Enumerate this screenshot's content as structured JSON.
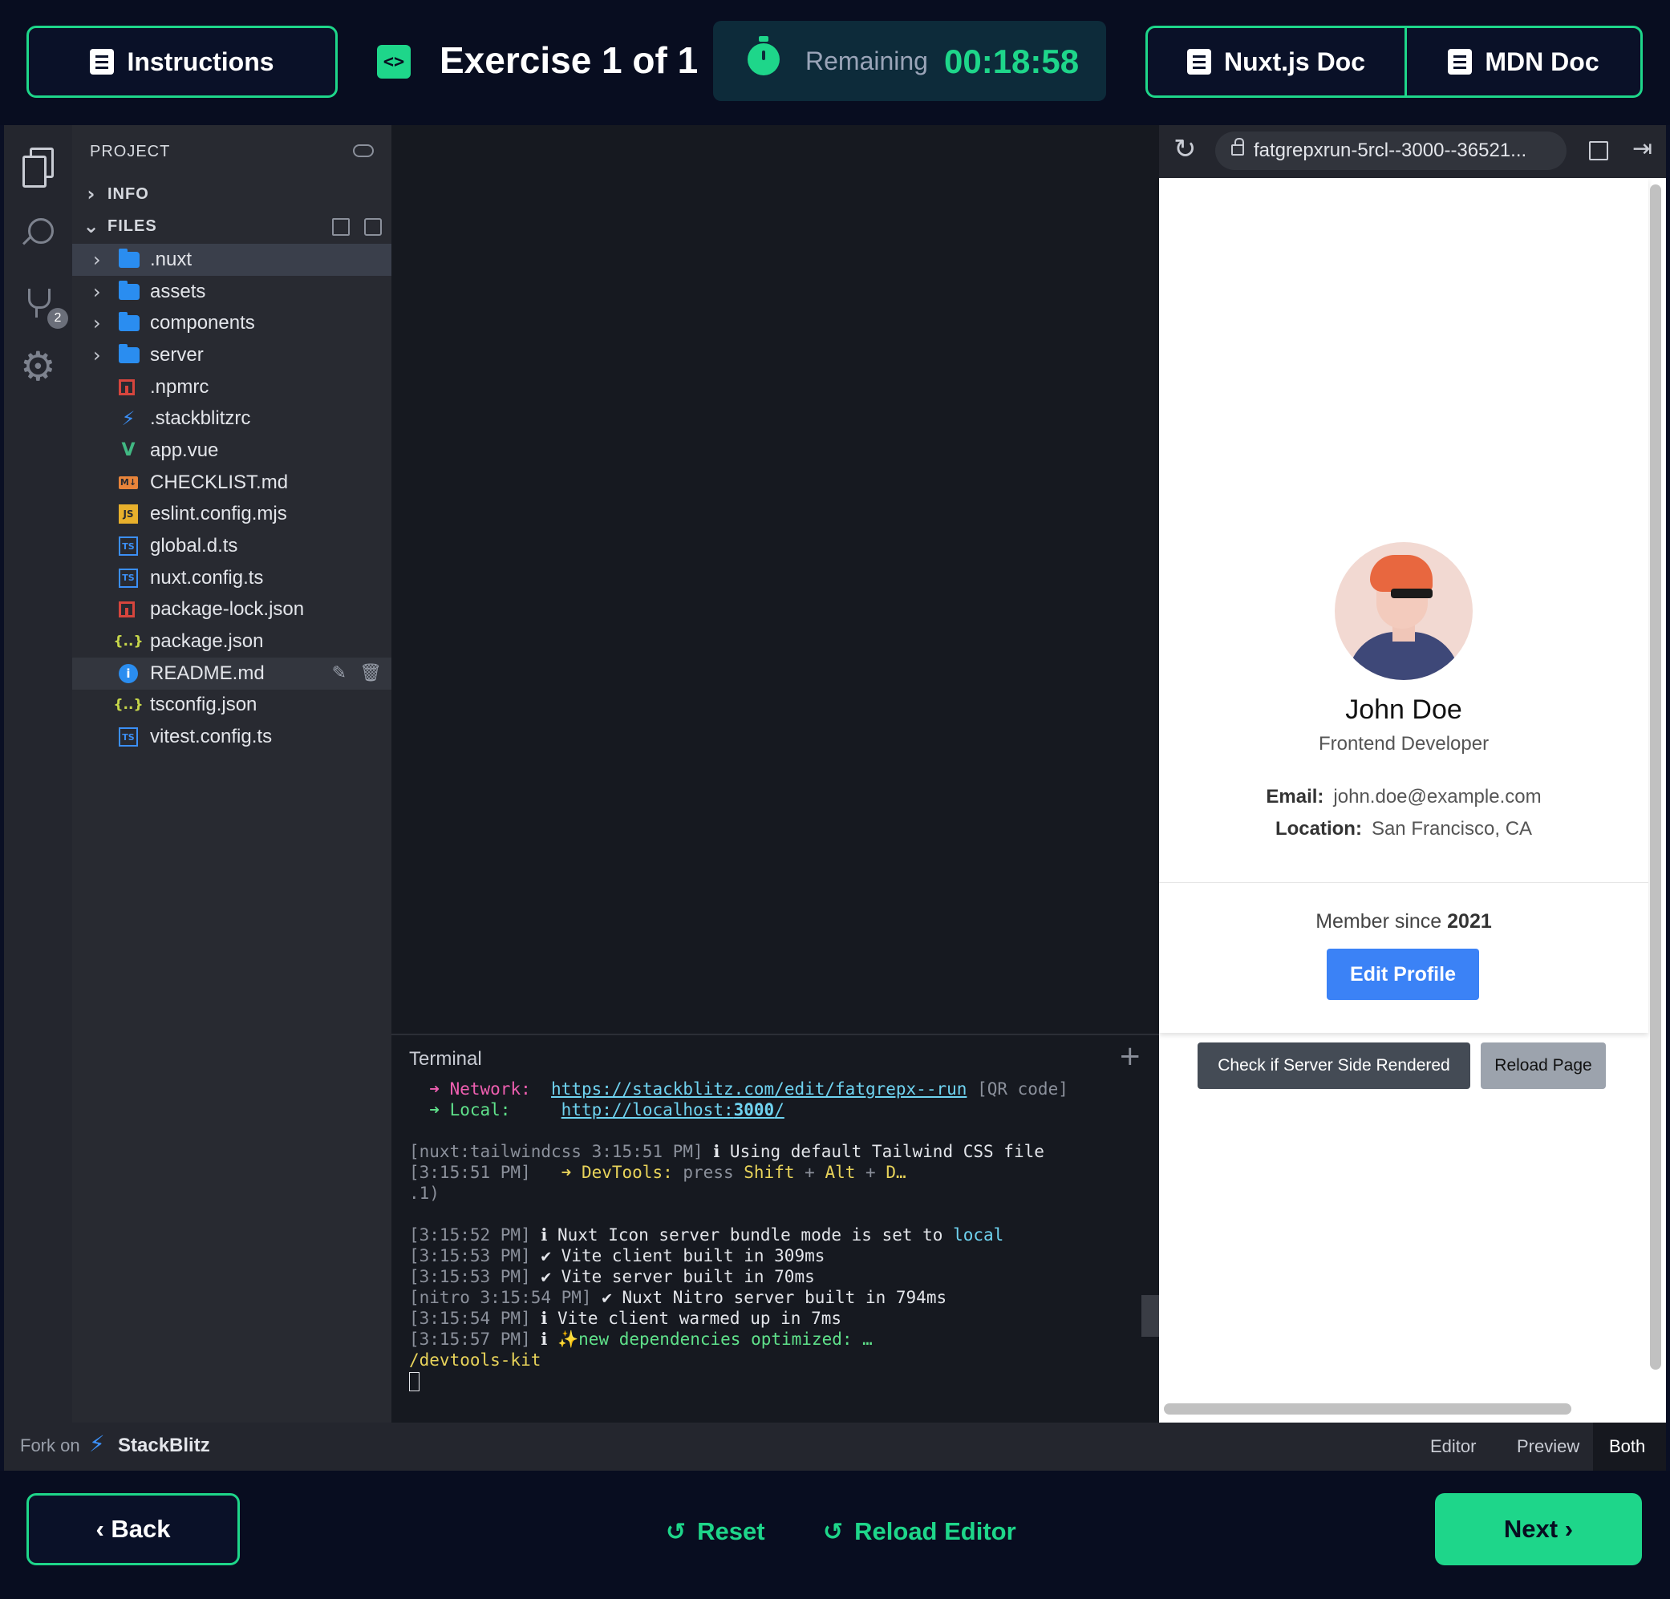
{
  "header": {
    "instructions_label": "Instructions",
    "code_icon_glyph": "<>",
    "exercise_title": "Exercise 1 of 1",
    "timer_label": "Remaining",
    "timer_value": "00:18:58",
    "nuxt_doc_label": "Nuxt.js Doc",
    "mdn_doc_label": "MDN Doc"
  },
  "activity_bar": {
    "icons": [
      "files-icon",
      "search-icon",
      "plug-icon",
      "gear-icon"
    ],
    "plug_badge": "2"
  },
  "sidebar": {
    "project_title": "PROJECT",
    "info_label": "INFO",
    "files_label": "FILES",
    "items": [
      {
        "label": ".nuxt",
        "type": "folder"
      },
      {
        "label": "assets",
        "type": "folder"
      },
      {
        "label": "components",
        "type": "folder"
      },
      {
        "label": "server",
        "type": "folder"
      },
      {
        "label": ".npmrc",
        "type": "npm"
      },
      {
        "label": ".stackblitzrc",
        "type": "bolt"
      },
      {
        "label": "app.vue",
        "type": "vue"
      },
      {
        "label": "CHECKLIST.md",
        "type": "md"
      },
      {
        "label": "eslint.config.mjs",
        "type": "js"
      },
      {
        "label": "global.d.ts",
        "type": "ts"
      },
      {
        "label": "nuxt.config.ts",
        "type": "ts"
      },
      {
        "label": "package-lock.json",
        "type": "npm"
      },
      {
        "label": "package.json",
        "type": "json"
      },
      {
        "label": "README.md",
        "type": "info"
      },
      {
        "label": "tsconfig.json",
        "type": "json"
      },
      {
        "label": "vitest.config.ts",
        "type": "ts"
      }
    ],
    "icon_glyphs": {
      "md": "M↓",
      "js": "JS",
      "ts": "TS",
      "json": "{..}",
      "info": "i",
      "bolt": "⚡",
      "vue": "V"
    }
  },
  "terminal": {
    "title": "Terminal",
    "network_arrow": "➜ Network:",
    "network_url": "https://stackblitz.com/edit/fatgrepx--run",
    "qr": "[QR code]",
    "local_arrow": "➜ Local:",
    "local_url_prefix": "http://localhost:",
    "local_url_port": "3000",
    "local_url_suffix": "/",
    "line_tw_prefix": "[nuxt:tailwindcss 3:15:51 PM]",
    "line_tw_text": "ℹ Using default Tailwind CSS file",
    "line_dev_prefix": "[3:15:51 PM]",
    "line_dev_arrow": "➜ DevTools:",
    "line_dev_press": "press",
    "line_dev_shift": "Shift",
    "line_dev_plus": "+",
    "line_dev_alt": "Alt",
    "line_dev_d": "D…",
    "line_dot1": ".1)",
    "line_icon_prefix": "[3:15:52 PM]",
    "line_icon_text": "ℹ Nuxt Icon server bundle mode is set to",
    "line_icon_local": "local",
    "line_vc_prefix": "[3:15:53 PM]",
    "line_vc_text": "✔ Vite client built in 309ms",
    "line_vs_prefix": "[3:15:53 PM]",
    "line_vs_text": "✔ Vite server built in 70ms",
    "line_nitro_prefix": "[nitro 3:15:54 PM]",
    "line_nitro_text": "✔ Nuxt Nitro server built in 794ms",
    "line_warm_prefix": "[3:15:54 PM]",
    "line_warm_text": "ℹ Vite client warmed up in 7ms",
    "line_deps_prefix": "[3:15:57 PM]",
    "line_deps_info": "ℹ",
    "line_deps_text": "✨new dependencies optimized: …",
    "line_devkit": "/devtools-kit"
  },
  "preview": {
    "url": "fatgrepxrun-5rcl--3000--36521...",
    "profile_name": "John Doe",
    "profile_role": "Frontend Developer",
    "email_label": "Email:",
    "email_value": "john.doe@example.com",
    "location_label": "Location:",
    "location_value": "San Francisco, CA",
    "member_since_label": "Member since",
    "member_since_year": "2021",
    "edit_profile_label": "Edit Profile",
    "ssr_check_label": "Check if Server Side Rendered",
    "reload_page_label": "Reload Page"
  },
  "footer": {
    "fork_label": "Fork on",
    "fork_brand": "StackBlitz",
    "view_editor": "Editor",
    "view_preview": "Preview",
    "view_both": "Both",
    "active_view": "Both"
  },
  "bottom": {
    "back_label": "‹ Back",
    "reset_label": "Reset",
    "reload_editor_label": "Reload Editor",
    "next_label": "Next ›"
  },
  "colors": {
    "accent_green": "#1ed68a",
    "header_bg": "#080d20",
    "edit_button_blue": "#3b82f6"
  }
}
